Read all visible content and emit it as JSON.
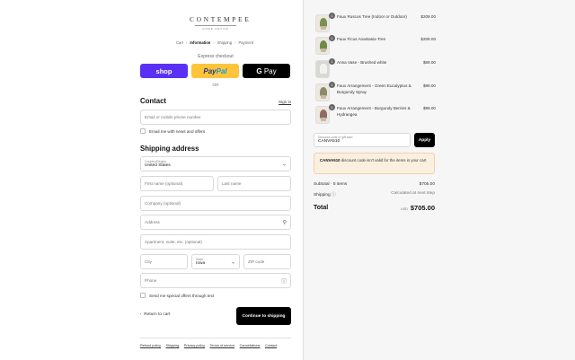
{
  "brand": {
    "name": "CONTEMPEE",
    "tagline": "HOME DECOR"
  },
  "breadcrumbs": [
    "Cart",
    "Information",
    "Shipping",
    "Payment"
  ],
  "express": {
    "title": "Express checkout",
    "shop_label": "shop",
    "paypal_part1": "Pay",
    "paypal_part2": "Pal",
    "gpay_g": "G",
    "gpay_label": "Pay",
    "divider": "OR"
  },
  "contact": {
    "heading": "Contact",
    "signin": "Sign in",
    "email_placeholder": "Email or mobile phone number",
    "newsletter_label": "Email me with news and offers"
  },
  "shipping": {
    "heading": "Shipping address",
    "country_label": "Country/Region",
    "country_value": "United States",
    "first_name": "First name (optional)",
    "last_name": "Last name",
    "company": "Company (optional)",
    "address": "Address",
    "apartment": "Apartment, suite, etc. (optional)",
    "city": "City",
    "state_label": "State",
    "state_value": "Iowa",
    "zip": "ZIP code",
    "phone": "Phone",
    "offers_label": "Send me special offers through text"
  },
  "actions": {
    "back": "Return to cart",
    "continue": "Continue to shipping"
  },
  "footer_links": [
    "Refund policy",
    "Shipping",
    "Privacy policy",
    "Terms of service",
    "Cancellations",
    "Contact"
  ],
  "items": [
    {
      "qty": "1",
      "name": "Faux Ruscus Tree (Indoor or Outdoor)",
      "price": "$209.00",
      "color": "#7a8f52"
    },
    {
      "qty": "1",
      "name": "Faux Ficus Anastasia Tree",
      "price": "$209.00",
      "color": "#6f8a45"
    },
    {
      "qty": "1",
      "name": "Anna Vase - Brushed white",
      "price": "$69.00",
      "color": "#e9e9e6"
    },
    {
      "qty": "1",
      "name": "Faux Arrangement - Green Eucalyptus & Burgundy Spray",
      "price": "$99.00",
      "color": "#8c8a6a"
    },
    {
      "qty": "1",
      "name": "Faux Arrangement - Burgundy Berries & Hydrangea",
      "price": "$99.00",
      "color": "#8f6a62"
    }
  ],
  "discount": {
    "label": "Discount code or gift card",
    "value": "CANVA510",
    "apply": "Apply",
    "error_code": "CANVA510",
    "error_text": "discount code isn't valid for the items in your cart"
  },
  "summary": {
    "subtotal_label": "Subtotal · 5 items",
    "subtotal_value": "$705.00",
    "shipping_label": "Shipping",
    "shipping_value": "Calculated at next step",
    "total_label": "Total",
    "currency": "USD",
    "total_value": "$705.00"
  },
  "colors": {
    "shop": "#5a31f4",
    "paypal": "#ffc439",
    "gpay": "#000000",
    "alert_bg": "#fbf0e0"
  }
}
